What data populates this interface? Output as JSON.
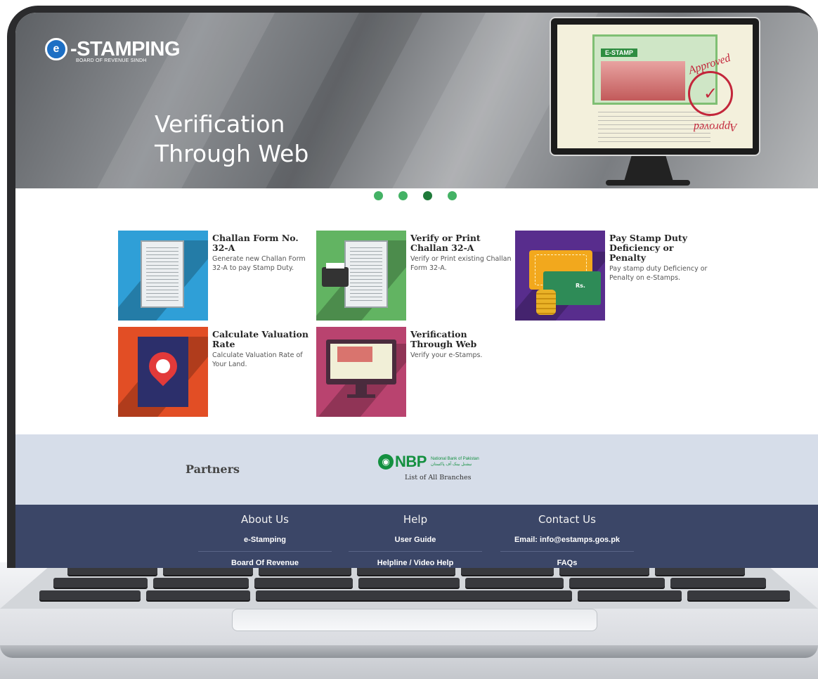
{
  "brand": {
    "logo_letter": "e",
    "logo_text": "-STAMPING",
    "logo_subtitle": "BOARD OF REVENUE SINDH"
  },
  "hero": {
    "title_line1": "Verification",
    "title_line2": "Through Web",
    "monitor_doc_label": "E-STAMP",
    "stamp_text_top": "Approved",
    "stamp_text_bottom": "Approved",
    "stamp_mark": "✓"
  },
  "carousel": {
    "slides": 4,
    "active_index": 3
  },
  "services": [
    {
      "title": "Challan Form No. 32-A",
      "description": "Generate new Challan Form 32-A to pay Stamp Duty.",
      "icon": "challan-form-icon",
      "color": "#2f9fd7"
    },
    {
      "title": "Verify or Print Challan 32-A",
      "description": "Verify or Print existing Challan Form 32-A.",
      "icon": "printer-icon",
      "color": "#62b462"
    },
    {
      "title": "Pay Stamp Duty Deficiency or Penalty",
      "description": "Pay stamp duty Deficiency or Penalty on e-Stamps.",
      "icon": "wallet-icon",
      "color": "#582d8d",
      "wallet_label": "Rs."
    },
    {
      "title": "Calculate Valuation Rate",
      "description": "Calculate Valuation Rate of Your Land.",
      "icon": "location-pin-icon",
      "color": "#e24e25"
    },
    {
      "title": "Verification Through Web",
      "description": "Verify your e-Stamps.",
      "icon": "monitor-icon",
      "color": "#b9436f"
    }
  ],
  "partners": {
    "label": "Partners",
    "nbp_logo": "NBP",
    "nbp_name_en": "National Bank of Pakistan",
    "nbp_name_ur": "نیشنل بینک آف پاکستان",
    "branches_link": "List of All Branches"
  },
  "footer": {
    "about": {
      "heading": "About Us",
      "link1": "e-Stamping",
      "link2": "Board Of Revenue"
    },
    "help": {
      "heading": "Help",
      "link1": "User Guide",
      "link2": "Helpline / Video Help"
    },
    "contact": {
      "heading": "Contact Us",
      "link1": "Email: info@estamps.gos.pk",
      "link2": "FAQs"
    }
  }
}
